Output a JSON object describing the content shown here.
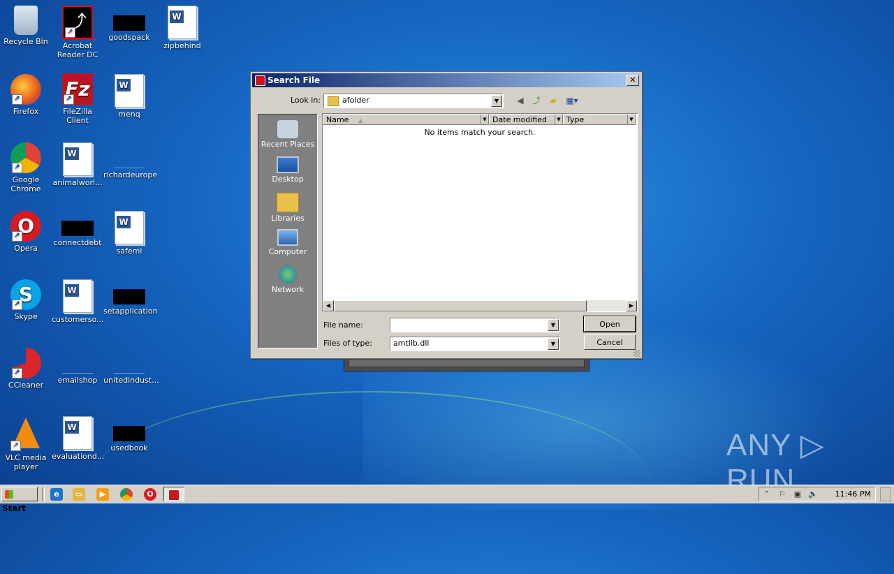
{
  "desktop": {
    "icons": [
      {
        "label": "Recycle Bin",
        "icon": "recycle-bin-icon"
      },
      {
        "label": "Acrobat Reader DC",
        "icon": "acrobat-icon"
      },
      {
        "label": "goodspack",
        "icon": "black-file-icon"
      },
      {
        "label": "zipbehind",
        "icon": "word-doc-icon"
      },
      {
        "label": "Firefox",
        "icon": "firefox-icon"
      },
      {
        "label": "FileZilla Client",
        "icon": "filezilla-icon"
      },
      {
        "label": "menq",
        "icon": "word-doc-icon"
      },
      {
        "label": "Google Chrome",
        "icon": "chrome-icon"
      },
      {
        "label": "animalworl...",
        "icon": "word-doc-icon"
      },
      {
        "label": "richardeurope",
        "icon": "blank-file-icon"
      },
      {
        "label": "Opera",
        "icon": "opera-icon"
      },
      {
        "label": "connectdebt",
        "icon": "black-file-icon"
      },
      {
        "label": "safemi",
        "icon": "word-doc-icon"
      },
      {
        "label": "Skype",
        "icon": "skype-icon"
      },
      {
        "label": "customerso...",
        "icon": "word-doc-icon"
      },
      {
        "label": "setapplication",
        "icon": "black-file-icon"
      },
      {
        "label": "CCleaner",
        "icon": "ccleaner-icon"
      },
      {
        "label": "emailshop",
        "icon": "blank-file-icon"
      },
      {
        "label": "unitedindust...",
        "icon": "blank-file-icon"
      },
      {
        "label": "VLC media player",
        "icon": "vlc-icon"
      },
      {
        "label": "evaluationd...",
        "icon": "word-doc-icon"
      },
      {
        "label": "usedbook",
        "icon": "black-file-icon"
      }
    ]
  },
  "dialog": {
    "title": "Search File",
    "look_in_label": "Look in:",
    "look_in_value": "afolder",
    "places": [
      {
        "label": "Recent Places"
      },
      {
        "label": "Desktop"
      },
      {
        "label": "Libraries"
      },
      {
        "label": "Computer"
      },
      {
        "label": "Network"
      }
    ],
    "columns": [
      "Name",
      "Date modified",
      "Type"
    ],
    "empty_message": "No items match your search.",
    "file_name_label": "File name:",
    "file_name_value": "",
    "files_of_type_label": "Files of type:",
    "files_of_type_value": "amtlib.dll",
    "open_label": "Open",
    "cancel_label": "Cancel",
    "close_glyph": "✕"
  },
  "taskbar": {
    "start_label": "Start",
    "clock": "11:46 PM"
  },
  "watermark": "ANY ▷ RUN"
}
